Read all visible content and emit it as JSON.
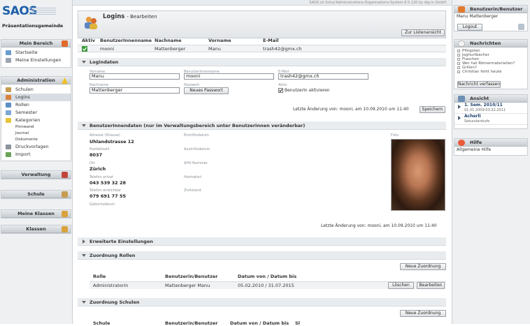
{
  "topbar": {
    "text": "SAOS.ch Schul-Administrations-Organisations-System 6.5.120 by dig-in GmbH"
  },
  "brand": {
    "logo": "SAOS",
    "org": "Präsentationsgemeinde"
  },
  "left": {
    "mein_bereich": {
      "title": "Mein Bereich",
      "items": [
        "Startseite",
        "Meine Einstellungen"
      ]
    },
    "administration": {
      "title": "Administration",
      "items": [
        "Schulen",
        "Logins",
        "Rollen",
        "Semester",
        "Kategorien"
      ],
      "sub_items": [
        "Pinnwand",
        "Journal",
        "Dokumente"
      ],
      "items_after": [
        "Druckvorlagen",
        "Import"
      ]
    },
    "collapsed": [
      "Verwaltung",
      "Schule",
      "Meine Klassen",
      "Klassen"
    ]
  },
  "page": {
    "title": "Logins",
    "subtitle": "- Bearbeiten",
    "back_button": "Zur Listenansicht"
  },
  "overview": {
    "headers": [
      "Aktiv",
      "BenutzerInnenname",
      "Nachname",
      "Vorname",
      "E-Mail"
    ],
    "row": {
      "username": "mooni",
      "nachname": "Mattenberger",
      "vorname": "Manu",
      "email": "trash42@gmx.ch"
    }
  },
  "logindaten": {
    "title": "Logindaten",
    "vorname_label": "Vorname",
    "vorname": "Manu",
    "username_label": "BenutzerInnenname",
    "username": "mooni",
    "email_label": "E-Mail",
    "email": "trash42@gmx.ch",
    "nachname_label": "Nachname",
    "nachname": "Mattenberger",
    "passwort_label": "Passwort",
    "passwort_button": "Neues Passwort",
    "aktiv_label": "Aktiv",
    "aktiv_checkbox": "BenutzerIn aktivieren",
    "last_change": "Letzte Änderung von: mooni, am 10.09.2010 um 11:40",
    "save_button": "Speichern"
  },
  "benutzerdaten": {
    "title": "BenutzerInnendaten (nur im Verwaltungsbereich unter BenutzerInnen veränderbar)",
    "fields": [
      {
        "label": "Adresse (Strasse)",
        "value": "Uhlandstrasse 12"
      },
      {
        "label": "Postleitzahl",
        "value": "8037"
      },
      {
        "label": "Ort",
        "value": "Zürich"
      },
      {
        "label": "Telefon privat",
        "value": "043 539 32 28"
      },
      {
        "label": "Telefon erreichbar",
        "value": "079 691 77 55"
      },
      {
        "label": "Geburtsdatum",
        "value": ""
      }
    ],
    "fields2": [
      "Eintrittsdatum",
      "Austrittsdatum",
      "AHV-Nummer",
      "Heimatort",
      "Zivilstand"
    ],
    "foto_label": "Foto",
    "last_change": "Letzte Änderung von: mooni, am 10.09.2010 um 11:40"
  },
  "erweitert": {
    "title": "Erweiterte Einstellungen"
  },
  "rollen": {
    "title": "Zuordnung Rollen",
    "new_button": "Neue Zuordnung",
    "headers": [
      "Rolle",
      "Benutzerin/Benutzer",
      "Datum von / Datum bis"
    ],
    "row": {
      "rolle": "AdministratorIn",
      "benutzer": "Mattenberger Manu",
      "datum": "05.02.2010 / 31.07.2015"
    },
    "delete_button": "Löschen",
    "edit_button": "Bearbeiten"
  },
  "schulen": {
    "title": "Zuordnung Schulen",
    "new_button": "Neue Zuordnung",
    "headers": [
      "Schule",
      "Benutzerin/Benutzer",
      "Datum von / Datum bis",
      "Sl"
    ]
  },
  "right": {
    "user": {
      "title": "Benutzerin/Benutzer",
      "name": "Manu Mattenberger",
      "logout": "Logout"
    },
    "nachrichten": {
      "title": "Nachrichten",
      "items": [
        "Pfingsten",
        "Joghurtbecher",
        "Flaschen",
        "Wer hat Römermaterialien?",
        "Grillen?",
        "Christian fehlt heute"
      ],
      "button": "Nachricht verfassen"
    },
    "ansicht": {
      "title": "Ansicht",
      "semester": "1. Sem. 2010/11",
      "semester_dates": "01.01.2009-03.02.2011",
      "school": "Acherli",
      "school_level": "Sekundarstufe"
    },
    "hilfe": {
      "title": "Hilfe",
      "text": "Allgemeine Hilfe"
    }
  },
  "colors": {
    "accent": "#1d5fa8",
    "panel": "#eef0f2",
    "header_grad_top": "#e7eaed",
    "header_grad_bottom": "#c7ccd2"
  }
}
